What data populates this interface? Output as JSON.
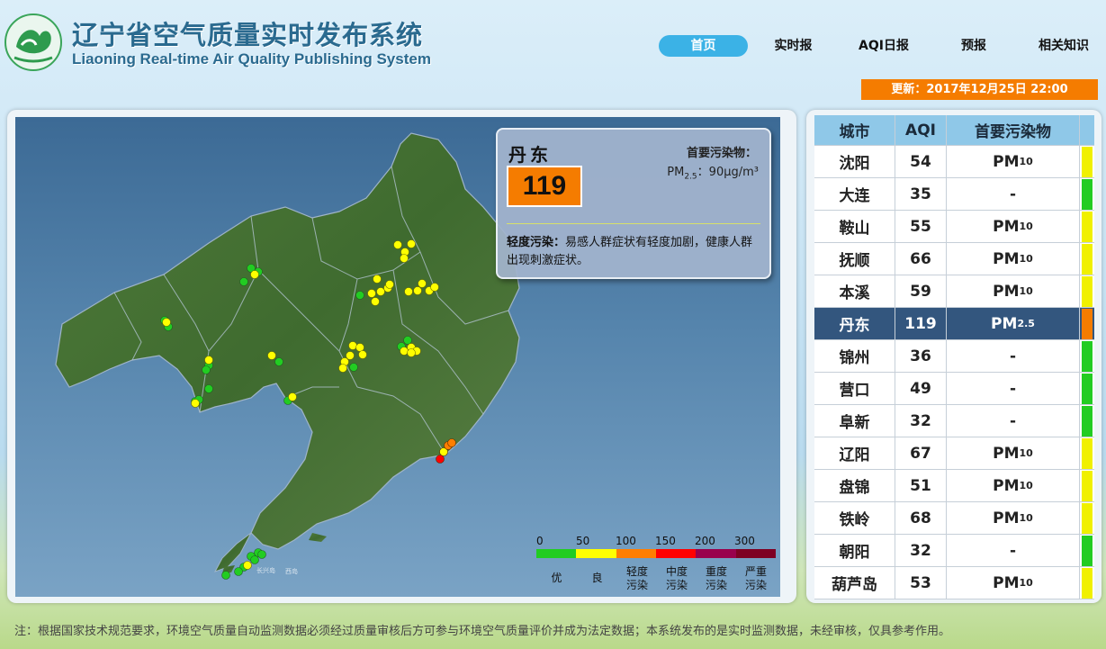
{
  "header": {
    "title_cn": "辽宁省空气质量实时发布系统",
    "title_en": "Liaoning Real-time Air Quality Publishing System"
  },
  "nav": [
    {
      "label": "首页",
      "active": true
    },
    {
      "label": "实时报",
      "active": false
    },
    {
      "label": "AQI日报",
      "active": false
    },
    {
      "label": "预报",
      "active": false
    },
    {
      "label": "相关知识",
      "active": false
    }
  ],
  "update_text": "更新：2017年12月25日 22:00",
  "info": {
    "city": "丹东",
    "aqi": "119",
    "pollutant_label": "首要污染物：",
    "pollutant_name": "PM",
    "pollutant_sub": "2.5",
    "pollutant_value": "：90μg/m³",
    "level": "轻度污染：",
    "description": "易感人群症状有轻度加剧，健康人群出现刺激症状。",
    "color": "#f57c00"
  },
  "legend": {
    "ticks": [
      "0",
      "50",
      "100",
      "150",
      "200",
      "300"
    ],
    "colors": [
      "#22cc22",
      "#ffff00",
      "#ff7e00",
      "#ff0000",
      "#99004c",
      "#7e0023"
    ],
    "levels": [
      "优",
      "良",
      "轻度污染",
      "中度污染",
      "重度污染",
      "严重污染"
    ]
  },
  "map_labels": [
    "长兴岛",
    "西岛"
  ],
  "table": {
    "headers": [
      "城市",
      "AQI",
      "首要污染物"
    ],
    "rows": [
      {
        "city": "沈阳",
        "aqi": "54",
        "pollutant": "PM",
        "sub": "10",
        "color": "#f0f000"
      },
      {
        "city": "大连",
        "aqi": "35",
        "pollutant": "-",
        "sub": "",
        "color": "#22cc22"
      },
      {
        "city": "鞍山",
        "aqi": "55",
        "pollutant": "PM",
        "sub": "10",
        "color": "#f0f000"
      },
      {
        "city": "抚顺",
        "aqi": "66",
        "pollutant": "PM",
        "sub": "10",
        "color": "#f0f000"
      },
      {
        "city": "本溪",
        "aqi": "59",
        "pollutant": "PM",
        "sub": "10",
        "color": "#f0f000"
      },
      {
        "city": "丹东",
        "aqi": "119",
        "pollutant": "PM",
        "sub": "2.5",
        "color": "#f57c00",
        "selected": true
      },
      {
        "city": "锦州",
        "aqi": "36",
        "pollutant": "-",
        "sub": "",
        "color": "#22cc22"
      },
      {
        "city": "营口",
        "aqi": "49",
        "pollutant": "-",
        "sub": "",
        "color": "#22cc22"
      },
      {
        "city": "阜新",
        "aqi": "32",
        "pollutant": "-",
        "sub": "",
        "color": "#22cc22"
      },
      {
        "city": "辽阳",
        "aqi": "67",
        "pollutant": "PM",
        "sub": "10",
        "color": "#f0f000"
      },
      {
        "city": "盘锦",
        "aqi": "51",
        "pollutant": "PM",
        "sub": "10",
        "color": "#f0f000"
      },
      {
        "city": "铁岭",
        "aqi": "68",
        "pollutant": "PM",
        "sub": "10",
        "color": "#f0f000"
      },
      {
        "city": "朝阳",
        "aqi": "32",
        "pollutant": "-",
        "sub": "",
        "color": "#22cc22"
      },
      {
        "city": "葫芦岛",
        "aqi": "53",
        "pollutant": "PM",
        "sub": "10",
        "color": "#f0f000"
      }
    ]
  },
  "note": "注：根据国家技术规范要求，环境空气质量自动监测数据必须经过质量审核后方可参与环境空气质量评价并成为法定数据；本系统发布的是实时监测数据，未经审核，仅具参考作用。"
}
